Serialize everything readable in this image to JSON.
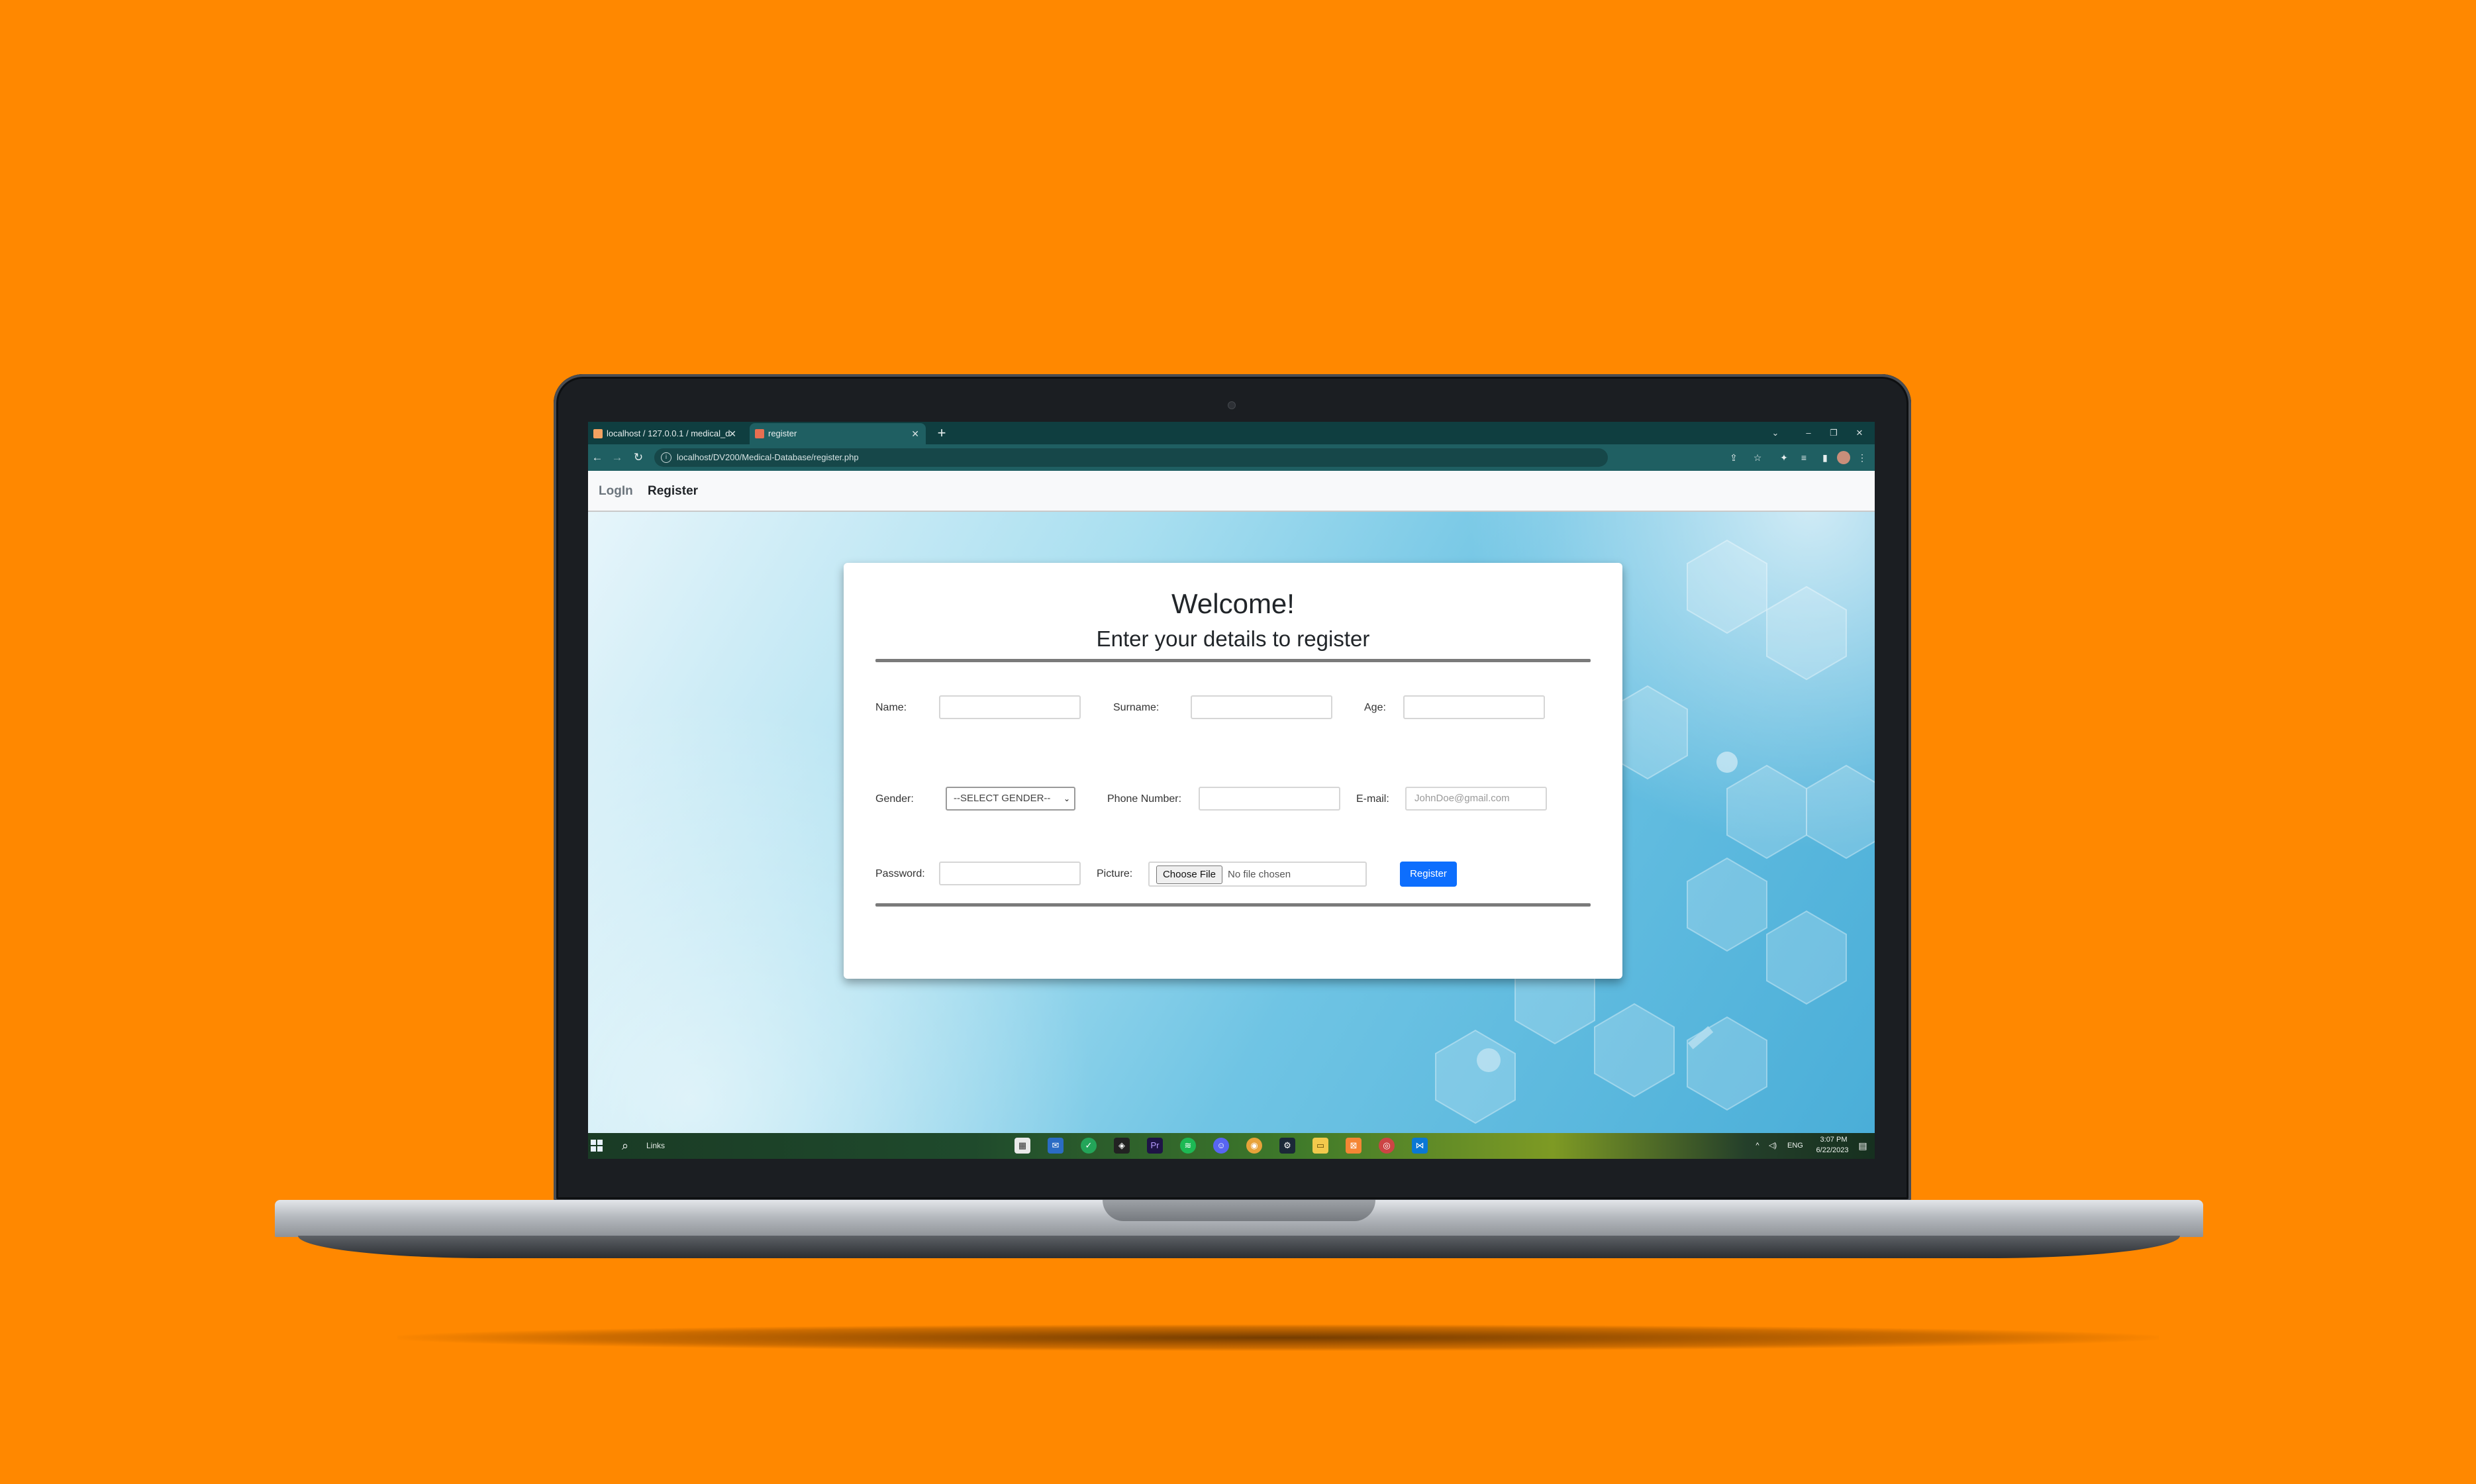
{
  "colors": {
    "background": "#ff8800",
    "accent": "#0d6efd",
    "browser_chrome": "#1f5f62"
  },
  "browser": {
    "tabs": [
      {
        "title": "localhost / 127.0.0.1 / medical_d",
        "icon": "phpmyadmin-icon"
      },
      {
        "title": "register",
        "icon": "page-icon"
      }
    ],
    "url": "localhost/DV200/Medical-Database/register.php"
  },
  "navbar": {
    "login_label": "LogIn",
    "register_label": "Register"
  },
  "form": {
    "title": "Welcome!",
    "subtitle": "Enter your details to register",
    "name_label": "Name:",
    "surname_label": "Surname:",
    "age_label": "Age:",
    "gender_label": "Gender:",
    "gender_selected": "--SELECT GENDER--",
    "phone_label": "Phone Number:",
    "email_label": "E-mail:",
    "email_placeholder": "JohnDoe@gmail.com",
    "password_label": "Password:",
    "picture_label": "Picture:",
    "choose_file_label": "Choose File",
    "no_file_label": "No file chosen",
    "register_button": "Register"
  },
  "taskbar": {
    "search_label": "Links",
    "language": "ENG",
    "time": "3:07 PM",
    "date": "6/22/2023"
  }
}
